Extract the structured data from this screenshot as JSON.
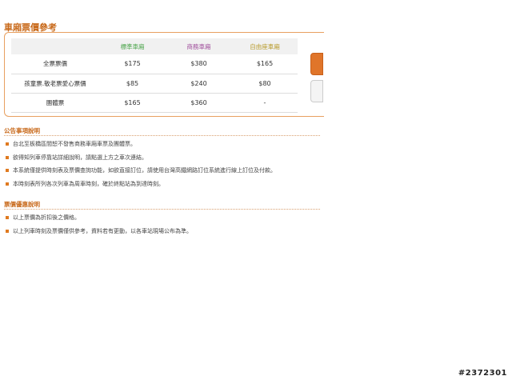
{
  "fare_section": {
    "title": "車廂票價參考",
    "columns": [
      "",
      "標準車廂",
      "商務車廂",
      "自由座車廂"
    ],
    "rows": [
      {
        "label": "全票票價",
        "standard": "$175",
        "business": "$380",
        "free": "$165"
      },
      {
        "label": "孩童票.敬老票愛心票價",
        "standard": "$85",
        "business": "$240",
        "free": "$80"
      },
      {
        "label": "團體票",
        "standard": "$165",
        "business": "$360",
        "free": "-"
      }
    ]
  },
  "notices": {
    "title": "公告事項說明",
    "items": [
      "台北至板橋區間恕不發售商務車廂車票及團體票。",
      "欲得知列車停靠站詳細說明，請點選上方之車次連結。",
      "本系統僅提供時刻表及票價查詢功能，如欲直接訂位，請使用台灣高鐵網路訂位系統進行線上訂位及付款。",
      "本時刻表所列各次列車為周車時刻，確於終點站為到達時刻。"
    ]
  },
  "discounts": {
    "title": "票價優惠說明",
    "items": [
      "以上票價為折扣後之價格。",
      "以上列車時刻及票價僅供參考，資料若有更動，以各車站現場公布為準。"
    ]
  },
  "watermark": "#2372301",
  "colors": {
    "accent": "#c8691a",
    "standard": "#4ea64e",
    "business": "#a04f9c",
    "free": "#b89a2a"
  }
}
